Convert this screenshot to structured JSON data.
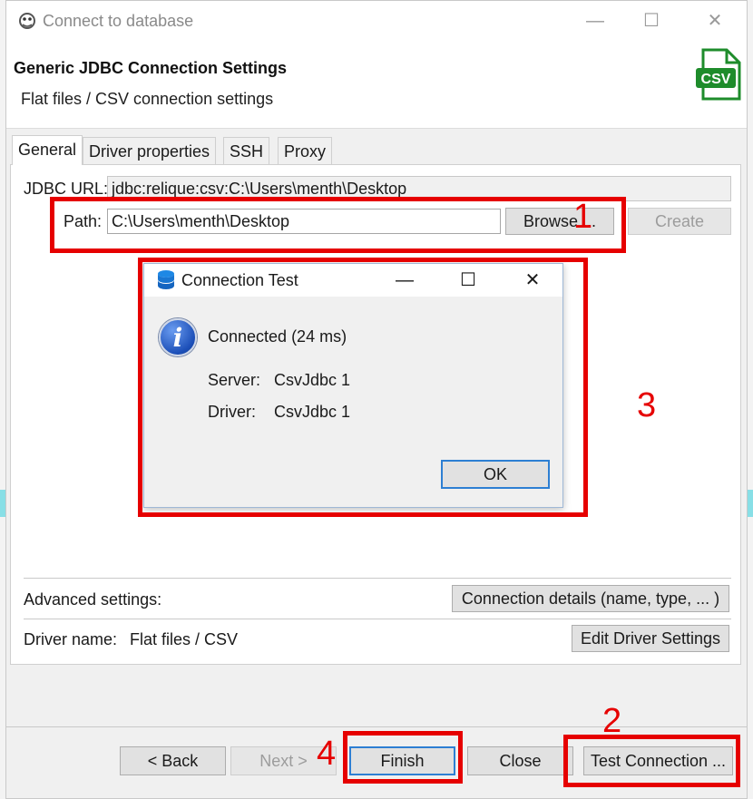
{
  "window": {
    "title": "Connect to database",
    "controls": {
      "minimize": "—",
      "maximize": "☐",
      "close": "✕"
    }
  },
  "header": {
    "title": "Generic JDBC Connection Settings",
    "subtitle": "Flat files / CSV connection settings",
    "icon_text": "CSV"
  },
  "tabs": [
    {
      "label": "General",
      "active": true
    },
    {
      "label": "Driver properties",
      "active": false
    },
    {
      "label": "SSH",
      "active": false
    },
    {
      "label": "Proxy",
      "active": false
    }
  ],
  "general": {
    "jdbc_url_label": "JDBC URL:",
    "jdbc_url_value": "jdbc:relique:csv:C:\\Users\\menth\\Desktop",
    "path_label": "Path:",
    "path_value": "C:\\Users\\menth\\Desktop",
    "browse_label": "Browse ...",
    "create_label": "Create",
    "advanced_label": "Advanced settings:",
    "connection_details_label": "Connection details (name, type, ... )",
    "driver_name_label": "Driver name:",
    "driver_name_value": "Flat files / CSV",
    "edit_driver_label": "Edit Driver Settings"
  },
  "connection_test": {
    "title": "Connection Test",
    "message": "Connected (24 ms)",
    "server_label": "Server:",
    "server_value": "CsvJdbc 1",
    "driver_label": "Driver:",
    "driver_value": "CsvJdbc 1",
    "ok_label": "OK",
    "controls": {
      "minimize": "—",
      "maximize": "☐",
      "close": "✕"
    }
  },
  "footer": {
    "back_label": "< Back",
    "next_label": "Next >",
    "finish_label": "Finish",
    "close_label": "Close",
    "test_connection_label": "Test Connection ..."
  },
  "annotations": {
    "n1": "1",
    "n2": "2",
    "n3": "3",
    "n4": "4",
    "color": "#e60000"
  }
}
